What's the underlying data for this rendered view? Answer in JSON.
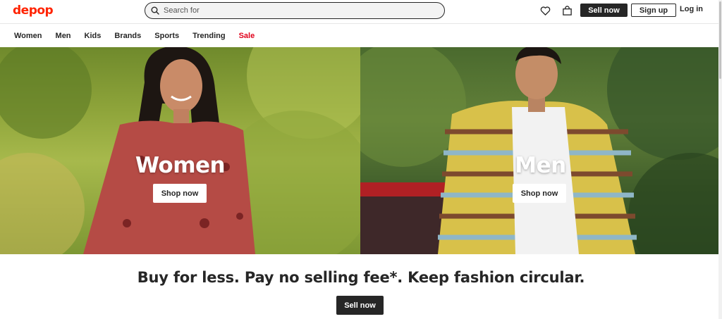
{
  "header": {
    "logo": "depop",
    "search_placeholder": "Search for",
    "sell_label": "Sell now",
    "signup_label": "Sign up",
    "login_label": "Log in"
  },
  "nav": {
    "items": [
      "Women",
      "Men",
      "Kids",
      "Brands",
      "Sports",
      "Trending",
      "Sale"
    ]
  },
  "heroes": {
    "left": {
      "title": "Women",
      "button": "Shop now"
    },
    "right": {
      "title": "Men",
      "button": "Shop now"
    }
  },
  "main": {
    "tagline": "Buy for less. Pay no selling fee*. Keep fashion circular.",
    "sell_label": "Sell now"
  },
  "colors": {
    "brand": "#ff2300",
    "sale": "#e0001b",
    "dark": "#262626"
  }
}
